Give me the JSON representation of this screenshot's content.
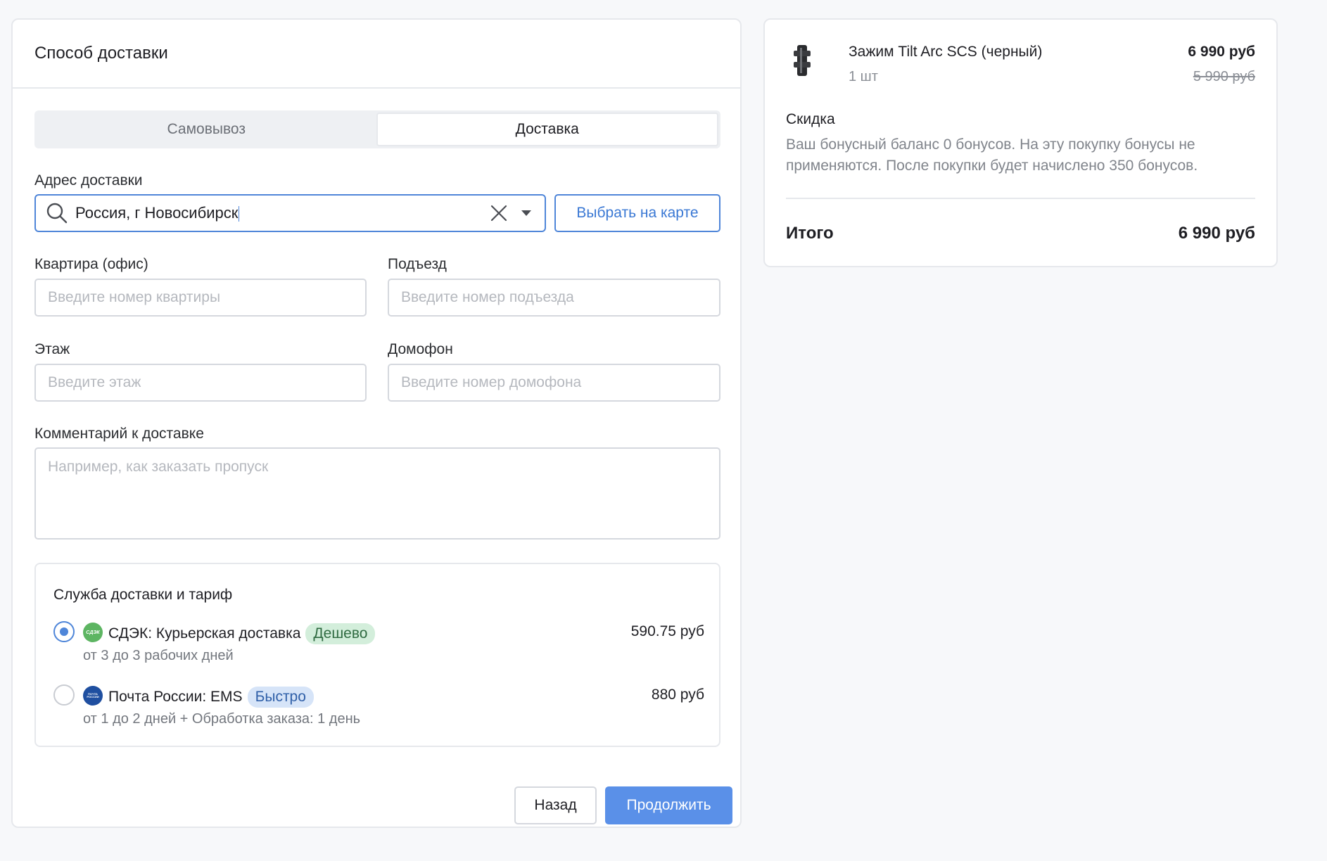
{
  "delivery": {
    "title": "Способ доставки",
    "tabs": [
      {
        "label": "Самовывоз",
        "active": false
      },
      {
        "label": "Доставка",
        "active": true
      }
    ],
    "address": {
      "label": "Адрес доставки",
      "value": "Россия, г Новосибирск",
      "map_button": "Выбрать на карте"
    },
    "fields": {
      "apartment": {
        "label": "Квартира (офис)",
        "placeholder": "Введите номер квартиры"
      },
      "entrance": {
        "label": "Подъезд",
        "placeholder": "Введите номер подъезда"
      },
      "floor": {
        "label": "Этаж",
        "placeholder": "Введите этаж"
      },
      "intercom": {
        "label": "Домофон",
        "placeholder": "Введите номер домофона"
      },
      "comment": {
        "label": "Комментарий к доставке",
        "placeholder": "Например, как заказать пропуск"
      }
    },
    "services": {
      "title": "Служба доставки и тариф",
      "options": [
        {
          "name": "СДЭК: Курьерская доставка",
          "logo_text": "СДЭК",
          "badge": "Дешево",
          "price": "590.75 руб",
          "term": "от 3 до 3 рабочих дней",
          "selected": true,
          "logo_color": "#5db562"
        },
        {
          "name": "Почта России: EMS",
          "logo_text": "ПОЧТА РОССИИ",
          "badge": "Быстро",
          "price": "880 руб",
          "term": "от 1 до 2 дней + Обработка заказа: 1 день",
          "selected": false,
          "logo_color": "#1f4fa0"
        }
      ]
    },
    "buttons": {
      "back": "Назад",
      "next": "Продолжить"
    },
    "accent_color": "#4f86d9"
  },
  "summary": {
    "product": {
      "name": "Зажим Tilt Arc SCS (черный)",
      "qty": "1 шт",
      "price": "6 990 руб",
      "old_price": "5 990 руб"
    },
    "discount": {
      "title": "Скидка",
      "text": "Ваш бонусный баланс 0 бонусов. На эту покупку бонусы не применяются. После покупки будет начислено 350 бонусов."
    },
    "total": {
      "label": "Итого",
      "value": "6 990 руб"
    }
  }
}
